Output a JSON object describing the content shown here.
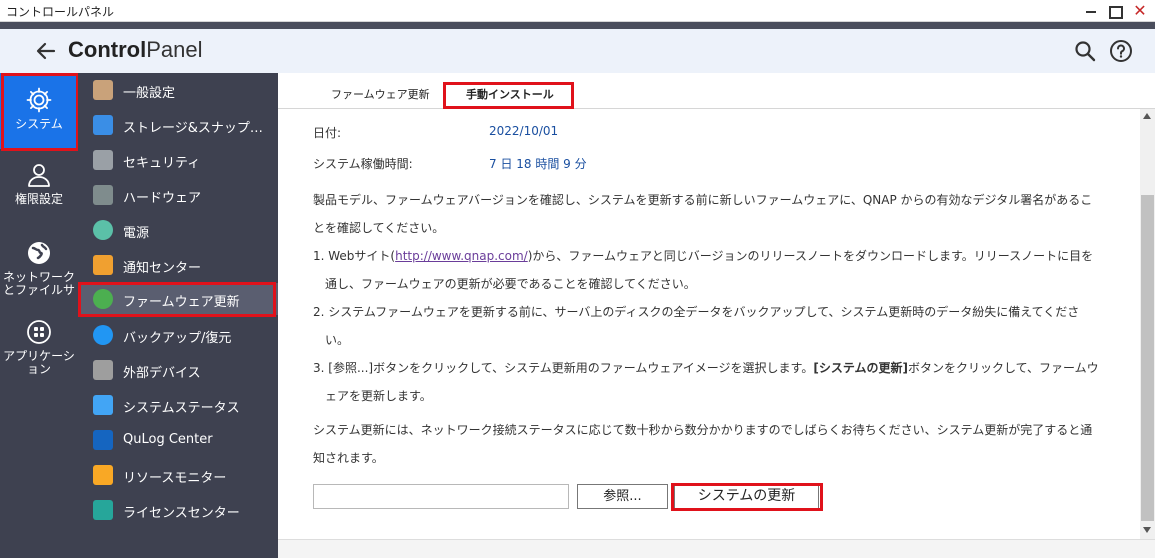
{
  "window": {
    "title": "コントロールパネル"
  },
  "header": {
    "title_bold": "Control",
    "title_rest": "Panel"
  },
  "rail": {
    "items": [
      {
        "label": "システム",
        "icon": "gear-icon",
        "active": true
      },
      {
        "label": "権限設定",
        "icon": "user-icon"
      },
      {
        "label": "ネットワーク\nとファイルサ",
        "label_line1": "ネットワーク",
        "label_line2": "とファイルサ",
        "icon": "globe-icon"
      },
      {
        "label_line1": "アプリケーシ",
        "label_line2": "ョン",
        "icon": "apps-icon"
      }
    ]
  },
  "sidebar": {
    "items": [
      {
        "label": "一般設定",
        "icon": "general-settings-icon",
        "color": "#c9a27a"
      },
      {
        "label": "ストレージ&スナップシ...",
        "icon": "storage-icon",
        "color": "#3a8ee6"
      },
      {
        "label": "セキュリティ",
        "icon": "lock-icon",
        "color": "#9aa0a6"
      },
      {
        "label": "ハードウェア",
        "icon": "hardware-icon",
        "color": "#7f8c8d"
      },
      {
        "label": "電源",
        "icon": "power-icon",
        "color": "#5bc0a8"
      },
      {
        "label": "通知センター",
        "icon": "notification-icon",
        "color": "#f0a030"
      },
      {
        "label": "ファームウェア更新",
        "icon": "firmware-icon",
        "color": "#4caf50",
        "active": true
      },
      {
        "label": "バックアップ/復元",
        "icon": "backup-icon",
        "color": "#2196f3"
      },
      {
        "label": "外部デバイス",
        "icon": "external-device-icon",
        "color": "#9e9e9e"
      },
      {
        "label": "システムステータス",
        "icon": "system-status-icon",
        "color": "#42a5f5"
      },
      {
        "label": "QuLog Center",
        "icon": "qulog-icon",
        "color": "#1565c0"
      },
      {
        "label": "リソースモニター",
        "icon": "resource-monitor-icon",
        "color": "#f9a825"
      },
      {
        "label": "ライセンスセンター",
        "icon": "license-icon",
        "color": "#26a69a"
      }
    ]
  },
  "tabs": [
    {
      "label": "ファームウェア更新"
    },
    {
      "label": "手動インストール",
      "active": true
    }
  ],
  "main": {
    "date_label": "日付:",
    "date_value": "2022/10/01",
    "uptime_label": "システム稼働時間:",
    "uptime_value": "7 日 18 時間 9 分",
    "intro": "製品モデル、ファームウェアバージョンを確認し、システムを更新する前に新しいファームウェアに、QNAP からの有効なデジタル署名があることを確認してください。",
    "step1_pre": "1. Webサイト(",
    "step1_link": "http://www.qnap.com/",
    "step1_post": ")から、ファームウェアと同じバージョンのリリースノートをダウンロードします。リリースノートに目を通し、ファームウェアの更新が必要であることを確認してください。",
    "step2": "2. システムファームウェアを更新する前に、サーバ上のディスクの全データをバックアップして、システム更新時のデータ紛失に備えてください。",
    "step3_pre": "3. [参照...]ボタンをクリックして、システム更新用のファームウェアイメージを選択します。",
    "step3_bold": "[システムの更新]",
    "step3_post": "ボタンをクリックして、ファームウェアを更新します。",
    "note": "システム更新には、ネットワーク接続ステータスに応じて数十秒から数分かかりますのでしばらくお待ちください、システム更新が完了すると通知されます。",
    "file_value": "",
    "browse_label": "参照...",
    "update_label": "システムの更新"
  },
  "colors": {
    "rail_bg": "#3e4150",
    "active_blue": "#1a73e8",
    "highlight_red": "#e0121b",
    "value_blue": "#1a4fa0"
  }
}
